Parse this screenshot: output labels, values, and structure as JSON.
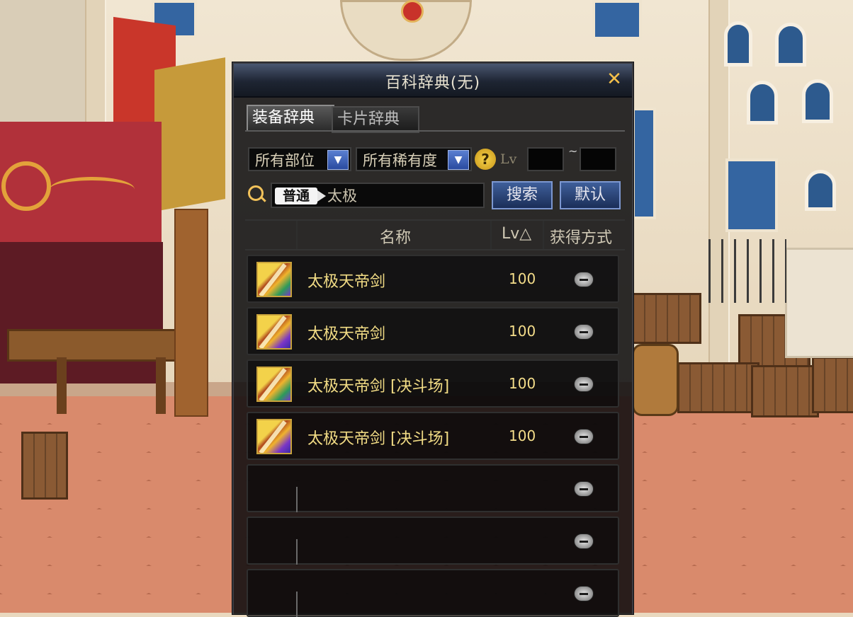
{
  "dialog": {
    "title": "百科辞典(无)",
    "close_glyph": "✕"
  },
  "tabs": [
    {
      "label": "装备辞典",
      "active": true
    },
    {
      "label": "卡片辞典",
      "active": false
    }
  ],
  "filters": {
    "part": "所有部位",
    "rarity": "所有稀有度",
    "help_glyph": "?",
    "lv_label": "Lv",
    "lv_min": "",
    "lv_max": "",
    "tilde": "~"
  },
  "search": {
    "mode_tag": "普通",
    "query": "太极",
    "search_button": "搜索",
    "default_button": "默认"
  },
  "table": {
    "headers": {
      "name": "名称",
      "lv": "Lv△",
      "obtain": "获得方式"
    },
    "rows": [
      {
        "name": "太极天帝剑",
        "lv": "100",
        "icon": "sword-icon-green"
      },
      {
        "name": "太极天帝剑",
        "lv": "100",
        "icon": "sword-icon-purple"
      },
      {
        "name": "太极天帝剑 [决斗场]",
        "lv": "100",
        "icon": "sword-icon-green"
      },
      {
        "name": "太极天帝剑 [决斗场]",
        "lv": "100",
        "icon": "sword-icon-purple"
      }
    ],
    "empty_rows": 3
  },
  "colors": {
    "item_name": "#f2dc85",
    "title_bar": "#1e2533",
    "button_blue": "#2a4ba0",
    "accent_gold": "#f2c25a"
  }
}
